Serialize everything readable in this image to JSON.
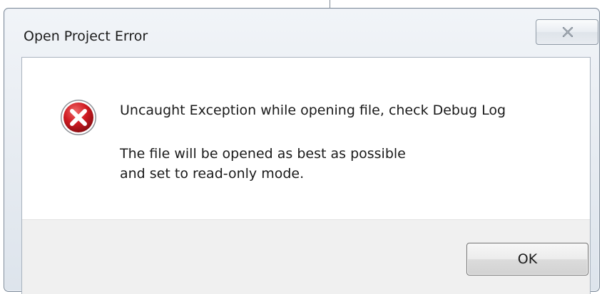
{
  "window": {
    "title": "Open Project Error"
  },
  "message": {
    "main": "Uncaught Exception while opening file, check Debug Log",
    "line1": "The file will be opened as best as possible",
    "line2": "and set to read-only mode."
  },
  "buttons": {
    "ok_label": "OK"
  },
  "icons": {
    "error": "error-icon",
    "close": "close-icon"
  },
  "colors": {
    "error_red": "#c8161d",
    "footer_gray": "#f0f0f0"
  }
}
